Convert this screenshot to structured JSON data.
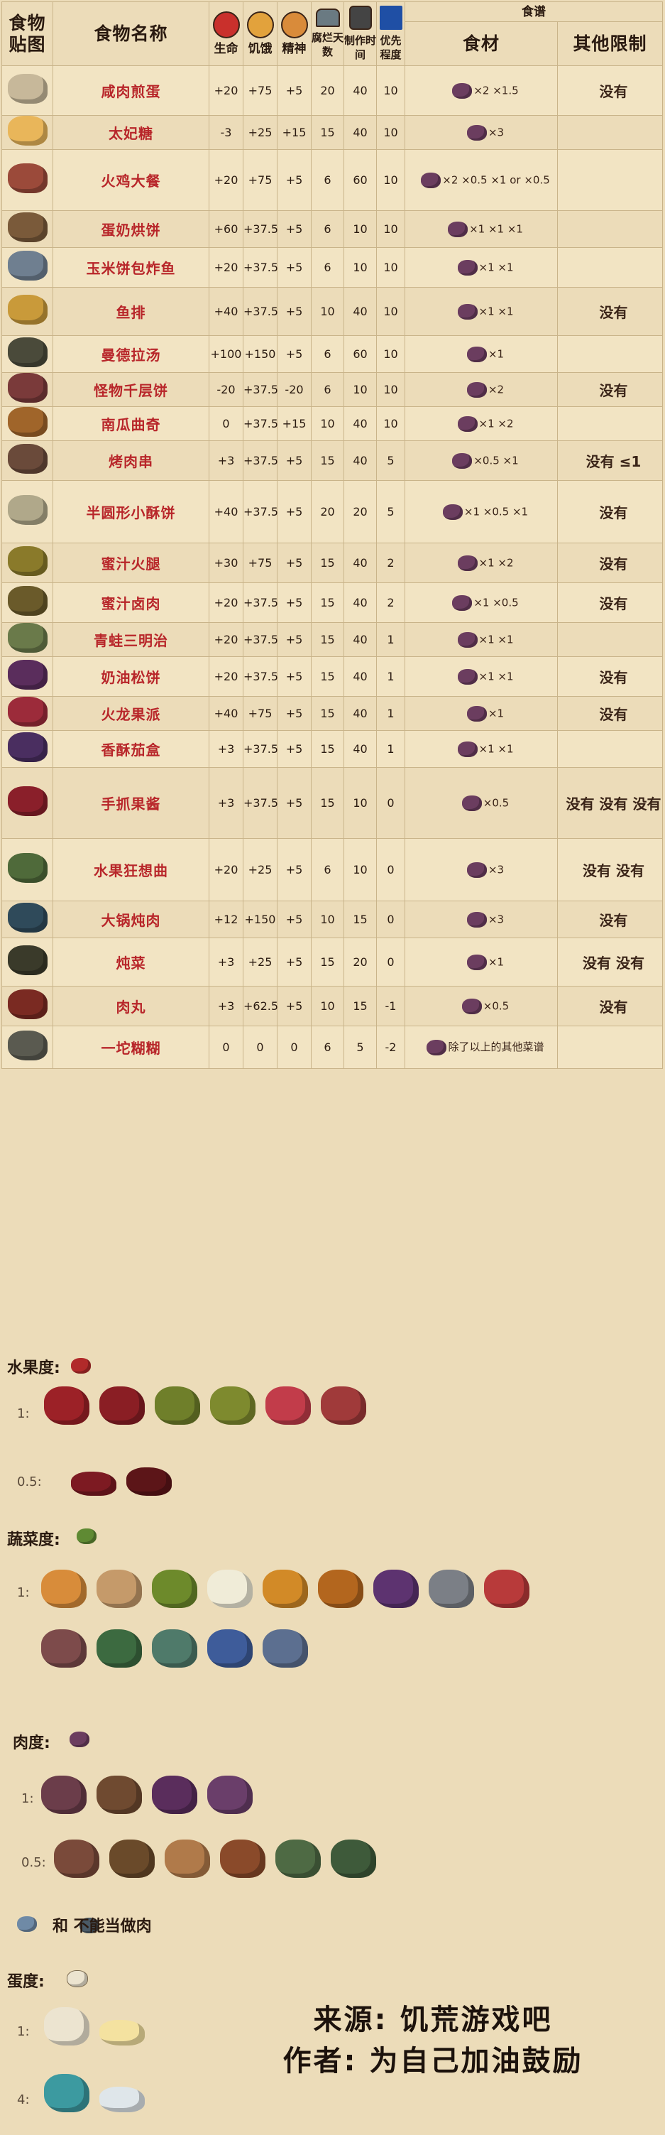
{
  "header": {
    "col_img": "食物贴图",
    "col_name": "食物名称",
    "col_health": "生命",
    "col_hunger": "饥饿",
    "col_sanity": "精神",
    "col_spoil": "腐烂天数",
    "col_cook": "制作时间",
    "col_priority": "优先程度",
    "recipe_group": "食谱",
    "col_ingredients": "食材",
    "col_restrictions": "其他限制"
  },
  "rows": [
    {
      "name": "咸肉煎蛋",
      "health": "+20",
      "hunger": "+75",
      "sanity": "+5",
      "spoil": "20",
      "cook": "40",
      "priority": "10",
      "ingredients": "×2  ×1.5",
      "restrictions": "没有"
    },
    {
      "name": "太妃糖",
      "health": "-3",
      "hunger": "+25",
      "sanity": "+15",
      "spoil": "15",
      "cook": "40",
      "priority": "10",
      "ingredients": "×3",
      "restrictions": ""
    },
    {
      "name": "火鸡大餐",
      "health": "+20",
      "hunger": "+75",
      "sanity": "+5",
      "spoil": "6",
      "cook": "60",
      "priority": "10",
      "ingredients": "×2  ×0.5  ×1 or ×0.5",
      "restrictions": ""
    },
    {
      "name": "蛋奶烘饼",
      "health": "+60",
      "hunger": "+37.5",
      "sanity": "+5",
      "spoil": "6",
      "cook": "10",
      "priority": "10",
      "ingredients": "×1  ×1  ×1",
      "restrictions": ""
    },
    {
      "name": "玉米饼包炸鱼",
      "health": "+20",
      "hunger": "+37.5",
      "sanity": "+5",
      "spoil": "6",
      "cook": "10",
      "priority": "10",
      "ingredients": "×1  ×1",
      "restrictions": ""
    },
    {
      "name": "鱼排",
      "health": "+40",
      "hunger": "+37.5",
      "sanity": "+5",
      "spoil": "10",
      "cook": "40",
      "priority": "10",
      "ingredients": "×1  ×1",
      "restrictions": "没有"
    },
    {
      "name": "曼德拉汤",
      "health": "+100",
      "hunger": "+150",
      "sanity": "+5",
      "spoil": "6",
      "cook": "60",
      "priority": "10",
      "ingredients": "×1",
      "restrictions": ""
    },
    {
      "name": "怪物千层饼",
      "health": "-20",
      "hunger": "+37.5",
      "sanity": "-20",
      "spoil": "6",
      "cook": "10",
      "priority": "10",
      "ingredients": "×2",
      "restrictions": "没有"
    },
    {
      "name": "南瓜曲奇",
      "health": "0",
      "hunger": "+37.5",
      "sanity": "+15",
      "spoil": "10",
      "cook": "40",
      "priority": "10",
      "ingredients": "×1  ×2",
      "restrictions": ""
    },
    {
      "name": "烤肉串",
      "health": "+3",
      "hunger": "+37.5",
      "sanity": "+5",
      "spoil": "15",
      "cook": "40",
      "priority": "5",
      "ingredients": "×0.5  ×1",
      "restrictions": "没有  ≤1"
    },
    {
      "name": "半圆形小酥饼",
      "health": "+40",
      "hunger": "+37.5",
      "sanity": "+5",
      "spoil": "20",
      "cook": "20",
      "priority": "5",
      "ingredients": "×1  ×0.5  ×1",
      "restrictions": "没有"
    },
    {
      "name": "蜜汁火腿",
      "health": "+30",
      "hunger": "+75",
      "sanity": "+5",
      "spoil": "15",
      "cook": "40",
      "priority": "2",
      "ingredients": "×1  ×2",
      "restrictions": "没有"
    },
    {
      "name": "蜜汁卤肉",
      "health": "+20",
      "hunger": "+37.5",
      "sanity": "+5",
      "spoil": "15",
      "cook": "40",
      "priority": "2",
      "ingredients": "×1  ×0.5",
      "restrictions": "没有"
    },
    {
      "name": "青蛙三明治",
      "health": "+20",
      "hunger": "+37.5",
      "sanity": "+5",
      "spoil": "15",
      "cook": "40",
      "priority": "1",
      "ingredients": "×1  ×1",
      "restrictions": ""
    },
    {
      "name": "奶油松饼",
      "health": "+20",
      "hunger": "+37.5",
      "sanity": "+5",
      "spoil": "15",
      "cook": "40",
      "priority": "1",
      "ingredients": "×1  ×1",
      "restrictions": "没有"
    },
    {
      "name": "火龙果派",
      "health": "+40",
      "hunger": "+75",
      "sanity": "+5",
      "spoil": "15",
      "cook": "40",
      "priority": "1",
      "ingredients": "×1",
      "restrictions": "没有"
    },
    {
      "name": "香酥茄盒",
      "health": "+3",
      "hunger": "+37.5",
      "sanity": "+5",
      "spoil": "15",
      "cook": "40",
      "priority": "1",
      "ingredients": "×1  ×1",
      "restrictions": ""
    },
    {
      "name": "手抓果酱",
      "health": "+3",
      "hunger": "+37.5",
      "sanity": "+5",
      "spoil": "15",
      "cook": "10",
      "priority": "0",
      "ingredients": "×0.5",
      "restrictions": "没有  没有  没有"
    },
    {
      "name": "水果狂想曲",
      "health": "+20",
      "hunger": "+25",
      "sanity": "+5",
      "spoil": "6",
      "cook": "10",
      "priority": "0",
      "ingredients": "×3",
      "restrictions": "没有  没有"
    },
    {
      "name": "大锅炖肉",
      "health": "+12",
      "hunger": "+150",
      "sanity": "+5",
      "spoil": "10",
      "cook": "15",
      "priority": "0",
      "ingredients": "×3",
      "restrictions": "没有"
    },
    {
      "name": "炖菜",
      "health": "+3",
      "hunger": "+25",
      "sanity": "+5",
      "spoil": "15",
      "cook": "20",
      "priority": "0",
      "ingredients": "×1",
      "restrictions": "没有  没有"
    },
    {
      "name": "肉丸",
      "health": "+3",
      "hunger": "+62.5",
      "sanity": "+5",
      "spoil": "10",
      "cook": "15",
      "priority": "-1",
      "ingredients": "×0.5",
      "restrictions": "没有"
    },
    {
      "name": "一坨糊糊",
      "health": "0",
      "hunger": "0",
      "sanity": "0",
      "spoil": "6",
      "cook": "5",
      "priority": "-2",
      "ingredients": "除了以上的其他菜谱",
      "restrictions": ""
    }
  ],
  "categories": {
    "fruit_title": "水果度:",
    "fruit_1": "1:",
    "fruit_05": "0.5:",
    "veg_title": "蔬菜度:",
    "veg_1": "1:",
    "meat_title": "肉度:",
    "meat_1": "1:",
    "meat_05": "0.5:",
    "fish_note": "和       不能当做肉",
    "egg_title": "蛋度:",
    "egg_1": "1:",
    "egg_4": "4:"
  },
  "credits": {
    "source": "来源: 饥荒游戏吧",
    "author": "作者: 为自己加油鼓励"
  },
  "colors": {
    "background": "#ecdcb9",
    "name_red": "#b8262a",
    "grid": "#c9b48a"
  }
}
